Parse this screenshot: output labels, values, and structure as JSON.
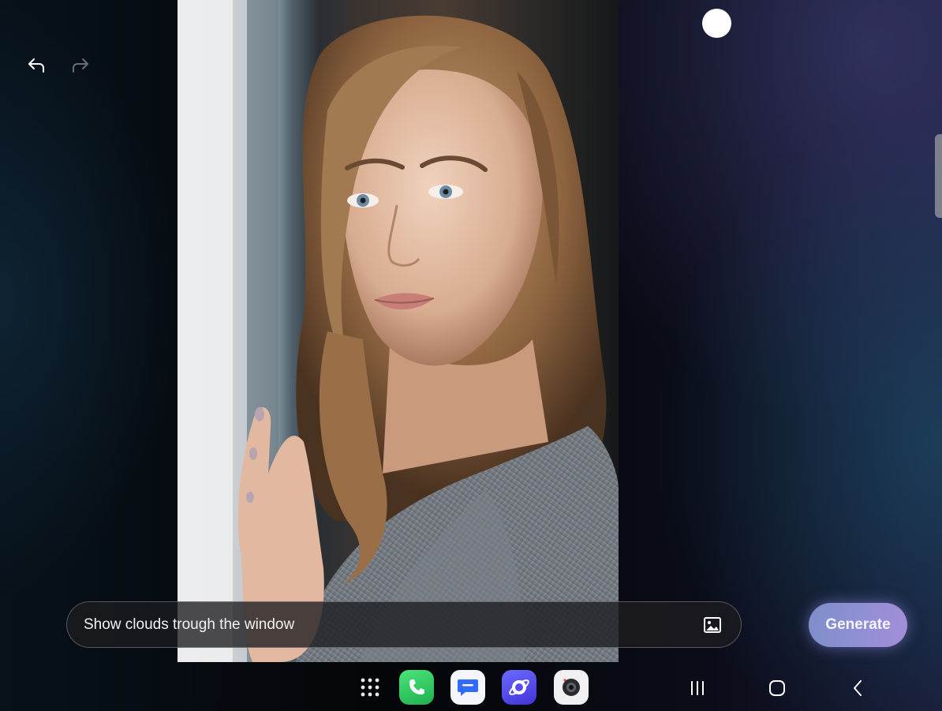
{
  "prompt": {
    "value": "Show clouds trough the window"
  },
  "actions": {
    "generate_label": "Generate"
  },
  "toolbar": {
    "undo_icon": "undo-icon",
    "redo_icon": "redo-icon"
  },
  "taskbar": {
    "apps": [
      "apps-grid-icon",
      "phone-app-icon",
      "messages-app-icon",
      "internet-app-icon",
      "camera-app-icon"
    ],
    "nav": [
      "recents-icon",
      "home-icon",
      "back-icon"
    ]
  },
  "colors": {
    "accent_generate": "#8f8fd6",
    "background": "#050608"
  }
}
